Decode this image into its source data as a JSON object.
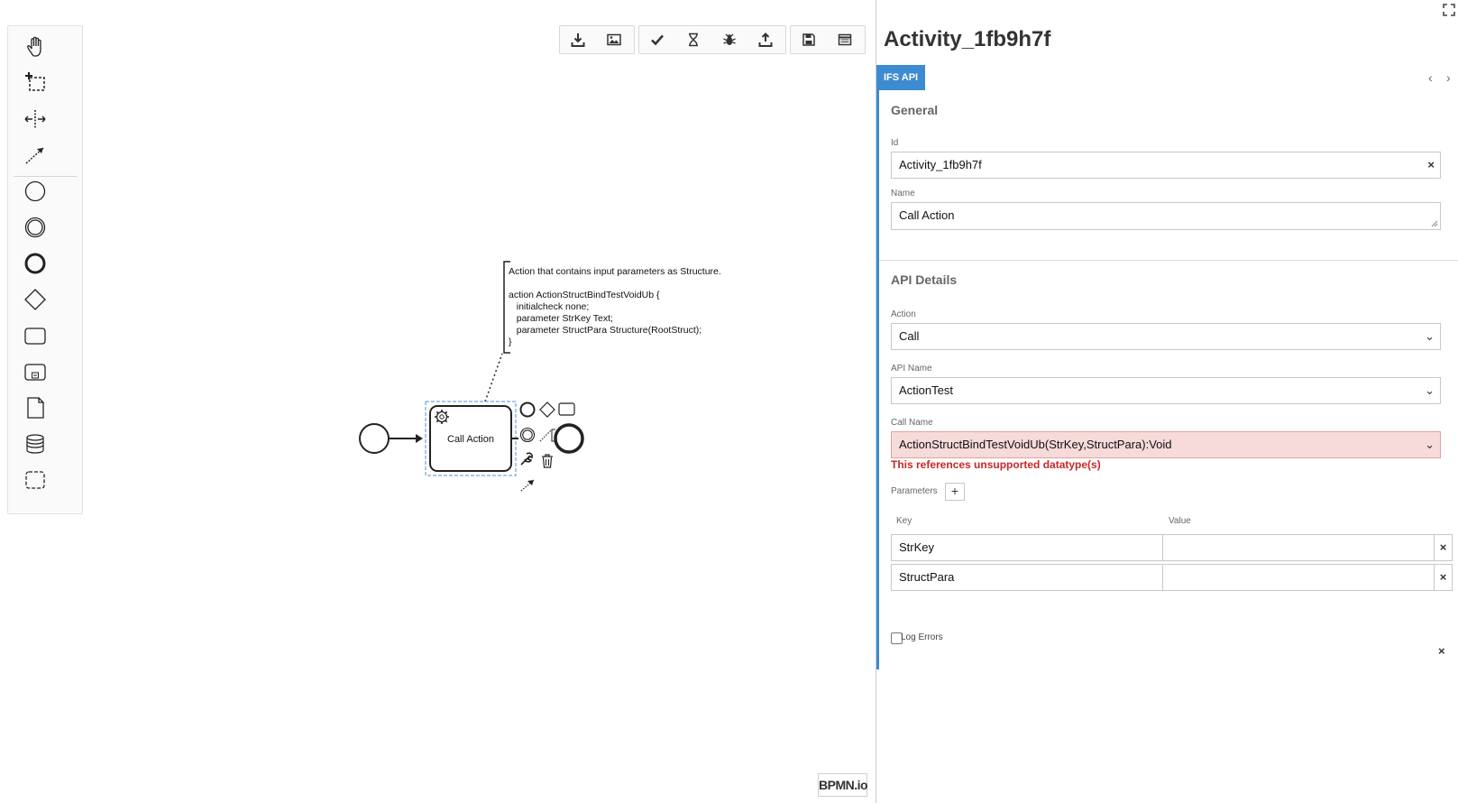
{
  "palette": {
    "tools": [
      "hand-tool",
      "lasso-tool",
      "space-tool",
      "global-connect-tool"
    ],
    "shapes": [
      "start-event",
      "intermediate-event",
      "end-event",
      "gateway",
      "task",
      "subprocess",
      "data-object",
      "data-store",
      "group"
    ]
  },
  "toolbar": {
    "groups": [
      [
        "download-icon",
        "image-icon"
      ],
      [
        "check-icon",
        "hourglass-icon",
        "bug-icon",
        "upload-icon"
      ],
      [
        "save-icon",
        "list-icon"
      ]
    ]
  },
  "diagram": {
    "task_label": "Call Action",
    "annotation_lines": [
      "Action that contains input parameters as Structure.",
      "",
      "action ActionStructBindTestVoidUb {",
      "   initialcheck none;",
      "   parameter StrKey Text;",
      "   parameter StructPara Structure(RootStruct);",
      "}"
    ]
  },
  "panel": {
    "title": "Activity_1fb9h7f",
    "tab_label": "IFS API",
    "general": {
      "title": "General",
      "id_label": "Id",
      "id_value": "Activity_1fb9h7f",
      "name_label": "Name",
      "name_value": "Call Action"
    },
    "api": {
      "title": "API Details",
      "action_label": "Action",
      "action_value": "Call",
      "api_name_label": "API Name",
      "api_name_value": "ActionTest",
      "call_name_label": "Call Name",
      "call_name_value": "ActionStructBindTestVoidUb(StrKey,StructPara):Void",
      "error": "This references unsupported datatype(s)",
      "params_label": "Parameters",
      "key_header": "Key",
      "value_header": "Value",
      "params": [
        {
          "key": "StrKey",
          "value": ""
        },
        {
          "key": "StructPara",
          "value": ""
        }
      ],
      "log_errors_label": "Log Errors"
    }
  },
  "logo_text": "BPMN.io",
  "colors": {
    "accent": "#3d8bd1",
    "error_text": "#c62828",
    "error_bg": "#f7dada",
    "selection": "#4a90e2"
  }
}
